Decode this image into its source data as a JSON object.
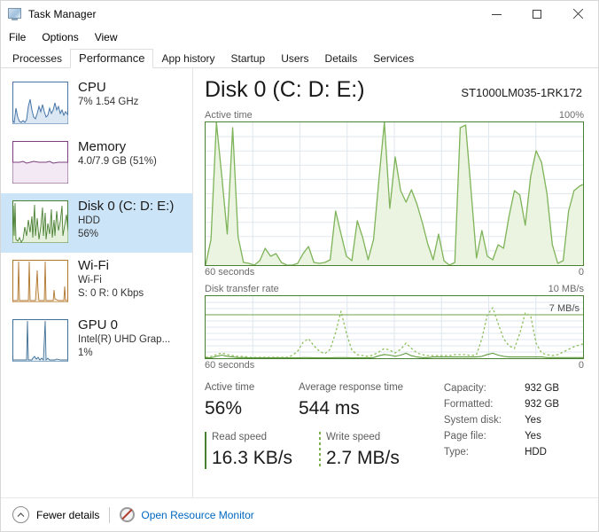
{
  "window": {
    "title": "Task Manager",
    "icon": "task-manager-icon",
    "controls": {
      "minimize": "minimize-icon",
      "maximize": "maximize-icon",
      "close": "close-icon"
    }
  },
  "menu": {
    "items": [
      "File",
      "Options",
      "View"
    ]
  },
  "tabs": {
    "active": "Performance",
    "items": [
      "Processes",
      "Performance",
      "App history",
      "Startup",
      "Users",
      "Details",
      "Services"
    ]
  },
  "sidebar": {
    "items": [
      {
        "id": "cpu",
        "title": "CPU",
        "sub1": "7%  1.54 GHz",
        "sub2": "",
        "color": "#4775a8",
        "fill": "#dbe8f3",
        "selected": false
      },
      {
        "id": "memory",
        "title": "Memory",
        "sub1": "4.0/7.9 GB (51%)",
        "sub2": "",
        "color": "#7b3f7d",
        "fill": "#f3e9f4",
        "selected": false
      },
      {
        "id": "disk-0",
        "title": "Disk 0 (C: D: E:)",
        "sub1": "HDD",
        "sub2": "56%",
        "color": "#4a8033",
        "fill": "#e6f1dd",
        "selected": true
      },
      {
        "id": "wifi",
        "title": "Wi-Fi",
        "sub1": "Wi-Fi",
        "sub2": "S: 0 R: 0 Kbps",
        "color": "#b0762e",
        "fill": "#f7ecd9",
        "selected": false
      },
      {
        "id": "gpu-0",
        "title": "GPU 0",
        "sub1": "Intel(R) UHD Grap...",
        "sub2": "1%",
        "color": "#3f6f96",
        "fill": "#e2ecf4",
        "selected": false
      }
    ]
  },
  "main": {
    "title": "Disk 0 (C: D: E:)",
    "model": "ST1000LM035-1RK172",
    "graph_active": {
      "label": "Active time",
      "max_label": "100%",
      "x_left_label": "60 seconds",
      "x_right_label": "0"
    },
    "graph_transfer": {
      "label": "Disk transfer rate",
      "max_label": "10 MB/s",
      "annotation": "7 MB/s",
      "x_left_label": "60 seconds",
      "x_right_label": "0"
    },
    "stats": {
      "active_time": {
        "label": "Active time",
        "value": "56%"
      },
      "avg_response": {
        "label": "Average response time",
        "value": "544 ms"
      },
      "read_speed": {
        "label": "Read speed",
        "value": "16.3 KB/s"
      },
      "write_speed": {
        "label": "Write speed",
        "value": "2.7 MB/s"
      },
      "info": [
        {
          "key": "Capacity:",
          "value": "932 GB"
        },
        {
          "key": "Formatted:",
          "value": "932 GB"
        },
        {
          "key": "System disk:",
          "value": "Yes"
        },
        {
          "key": "Page file:",
          "value": "Yes"
        },
        {
          "key": "Type:",
          "value": "HDD"
        }
      ]
    }
  },
  "statusbar": {
    "fewer_details": "Fewer details",
    "resource_monitor": "Open Resource Monitor",
    "chevron": "chevron-up-icon",
    "rm_icon": "resource-monitor-icon"
  },
  "chart_data": [
    {
      "type": "area",
      "id": "active-time",
      "title": "Active time",
      "ylabel": "Active time",
      "xlabel": "60 seconds",
      "ylim": [
        0,
        100
      ],
      "xlim": [
        60,
        0
      ],
      "grid": true,
      "line_color": "#7fb45a",
      "fill_color": "#eaf4e1",
      "values": [
        0,
        18,
        100,
        62,
        22,
        96,
        20,
        2,
        1,
        0,
        3,
        12,
        6,
        8,
        2,
        0,
        0,
        1,
        8,
        13,
        2,
        1,
        2,
        4,
        38,
        22,
        6,
        3,
        31,
        19,
        4,
        18,
        60,
        100,
        40,
        76,
        52,
        44,
        53,
        43,
        30,
        15,
        4,
        22,
        3,
        0,
        2,
        96,
        98,
        52,
        5,
        24,
        6,
        4,
        14,
        12,
        34,
        52,
        49,
        28,
        62,
        80,
        72,
        50,
        14,
        1,
        3,
        38,
        52,
        55
      ]
    },
    {
      "type": "line",
      "id": "disk-transfer-rate",
      "title": "Disk transfer rate",
      "ylabel": "Disk transfer rate",
      "xlabel": "60 seconds",
      "ylim": [
        0,
        10
      ],
      "xlim": [
        60,
        0
      ],
      "unit": "MB/s",
      "annotation": "7 MB/s",
      "grid": true,
      "series": [
        {
          "name": "Write speed",
          "style": "dashed",
          "color": "#8fc05e",
          "values": [
            0.1,
            0.2,
            0.6,
            0.9,
            0.5,
            0.4,
            0.3,
            0.3,
            0.2,
            0.2,
            0.2,
            0.1,
            0.1,
            0.1,
            0.1,
            0.2,
            0.4,
            1.1,
            2.6,
            3.2,
            2.0,
            1.1,
            0.7,
            1.4,
            4.2,
            7.6,
            4.0,
            1.3,
            0.6,
            0.4,
            0.3,
            0.5,
            1.0,
            1.5,
            1.3,
            0.8,
            1.4,
            2.4,
            1.6,
            0.8,
            0.5,
            0.4,
            0.4,
            0.4,
            0.4,
            0.4,
            0.5,
            0.6,
            0.5,
            0.4,
            0.5,
            3.2,
            7.0,
            8.2,
            5.5,
            3.2,
            2.0,
            1.6,
            4.0,
            7.3,
            6.8,
            2.4,
            0.8,
            0.5,
            0.4,
            0.5,
            0.9,
            1.3,
            1.7,
            2.0
          ]
        },
        {
          "name": "Read speed",
          "style": "solid",
          "color": "#5d9b3c",
          "values": [
            0.05,
            0.05,
            0.3,
            0.5,
            0.3,
            0.2,
            0.1,
            0.1,
            0.05,
            0.05,
            0.05,
            0.05,
            0.05,
            0.05,
            0.05,
            0.05,
            0.05,
            0.05,
            0.1,
            0.1,
            0.05,
            0.05,
            0.05,
            0.05,
            0.1,
            0.1,
            0.1,
            0.05,
            0.05,
            0.05,
            0.05,
            0.1,
            0.4,
            0.6,
            0.5,
            0.3,
            0.5,
            0.8,
            0.4,
            0.2,
            0.1,
            0.1,
            0.2,
            0.2,
            0.2,
            0.2,
            0.2,
            0.2,
            0.2,
            0.2,
            0.2,
            0.3,
            0.6,
            0.8,
            0.5,
            0.3,
            0.2,
            0.2,
            0.2,
            0.2,
            0.2,
            0.2,
            0.1,
            0.1,
            0.1,
            0.1,
            0.1,
            0.1,
            0.1,
            0.1
          ]
        }
      ]
    }
  ]
}
